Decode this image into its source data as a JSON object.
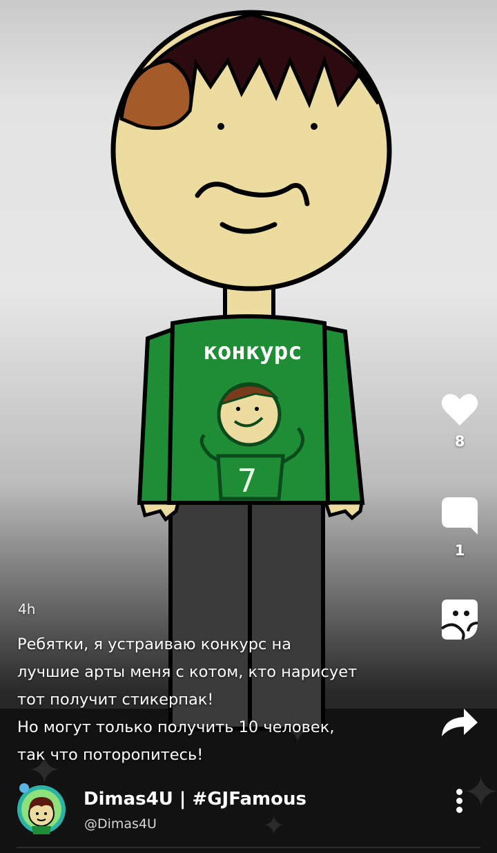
{
  "post": {
    "artwork": {
      "shirt_text": "конкурс",
      "shirt_number": "7",
      "colors": {
        "shirt": "#1f8c36",
        "skin": "#eddca0",
        "hair_dark": "#2b0a10",
        "hair_spot": "#a55a2a",
        "pants": "#3a3a3a"
      }
    },
    "time_ago": "4h",
    "caption_lines": [
      "Ребятки, я устраиваю конкурс на",
      "лучшие арты меня с котом, кто нарисует",
      "тот получит стикерпак!",
      "Но могут только получить 10 человек,",
      "так что поторопитесь!"
    ],
    "author": {
      "display_name": "Dimas4U | #GJFamous",
      "handle": "@Dimas4U"
    }
  },
  "actions": {
    "likes": {
      "icon": "heart-icon",
      "count": "8"
    },
    "comments": {
      "icon": "comment-icon",
      "count": "1"
    },
    "sticker": {
      "icon": "sticker-icon"
    },
    "share": {
      "icon": "share-arrow-icon"
    },
    "more": {
      "icon": "more-vertical-icon"
    }
  }
}
